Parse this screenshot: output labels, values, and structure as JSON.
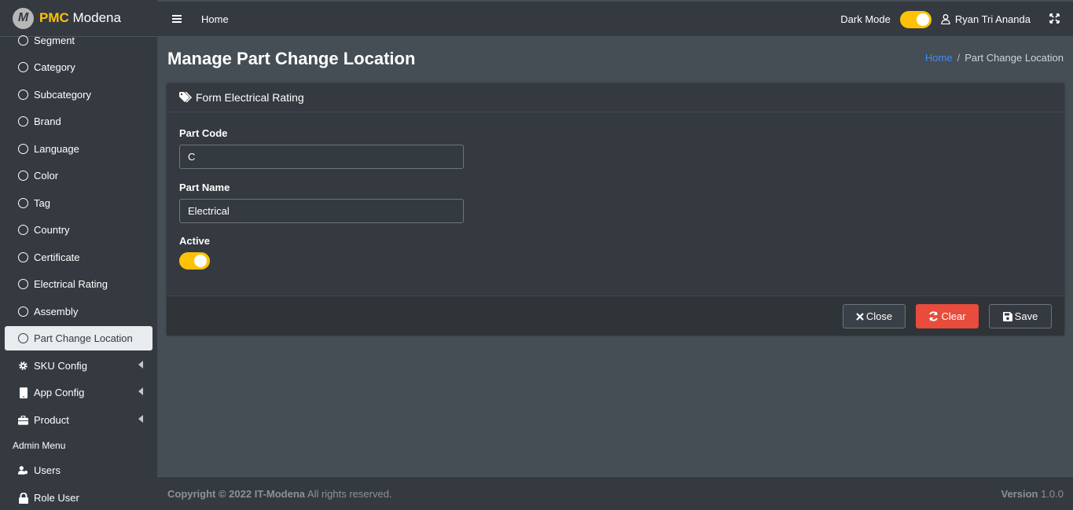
{
  "brand": {
    "logo_letter": "M",
    "accent": "PMC",
    "name": "Modena"
  },
  "sidebar": {
    "items": [
      {
        "label": "Segment"
      },
      {
        "label": "Category"
      },
      {
        "label": "Subcategory"
      },
      {
        "label": "Brand"
      },
      {
        "label": "Language"
      },
      {
        "label": "Color"
      },
      {
        "label": "Tag"
      },
      {
        "label": "Country"
      },
      {
        "label": "Certificate"
      },
      {
        "label": "Electrical Rating"
      },
      {
        "label": "Assembly"
      },
      {
        "label": "Part Change Location"
      }
    ],
    "groups": [
      {
        "label": "SKU Config",
        "icon": "gear-icon"
      },
      {
        "label": "App Config",
        "icon": "mobile-icon"
      },
      {
        "label": "Product",
        "icon": "briefcase-icon"
      }
    ],
    "admin_header": "Admin Menu",
    "admin_items": [
      {
        "label": "Users",
        "icon": "users-icon"
      },
      {
        "label": "Role User",
        "icon": "lock-icon"
      }
    ]
  },
  "topbar": {
    "home": "Home",
    "dark_mode_label": "Dark Mode",
    "user_name": "Ryan Tri Ananda"
  },
  "page": {
    "title": "Manage Part Change Location",
    "breadcrumb_home": "Home",
    "breadcrumb_sep": "/",
    "breadcrumb_current": "Part Change Location"
  },
  "form": {
    "header": "Form Electrical Rating",
    "part_code_label": "Part Code",
    "part_code_value": "C",
    "part_name_label": "Part Name",
    "part_name_value": "Electrical",
    "active_label": "Active",
    "close_label": "Close",
    "clear_label": "Clear",
    "save_label": "Save"
  },
  "footer": {
    "copyright": "Copyright © 2022 IT-Modena",
    "rights": " All rights reserved.",
    "version_label": "Version",
    "version_value": " 1.0.0"
  },
  "colors": {
    "accent": "#ffc107",
    "clear": "#e74c3c",
    "link": "#3f8cff"
  }
}
